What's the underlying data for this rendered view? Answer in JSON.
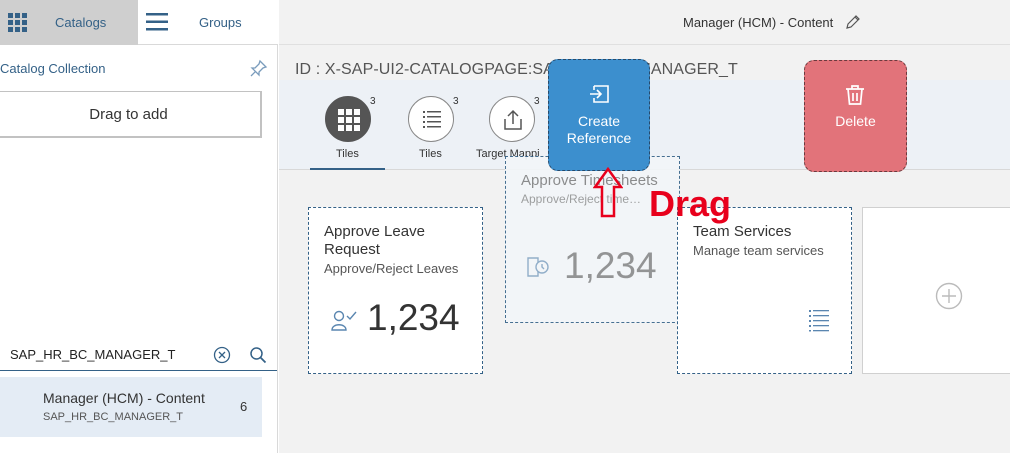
{
  "left": {
    "tabs": {
      "catalogs": "Catalogs",
      "groups": "Groups"
    },
    "collection_label": "Catalog Collection",
    "drag_to_add": "Drag to add",
    "search": {
      "value": "SAP_HR_BC_MANAGER_T"
    },
    "catalog_item": {
      "title": "Manager (HCM) - Content",
      "subtitle": "SAP_HR_BC_MANAGER_T",
      "count": "6"
    }
  },
  "main": {
    "header_title": "Manager (HCM) - Content",
    "page_id": "ID : X-SAP-UI2-CATALOGPAGE:SAP_HR_BC_MANAGER_T",
    "iconbar": [
      {
        "label": "Tiles",
        "count": "3",
        "icon": "grid-icon"
      },
      {
        "label": "Tiles",
        "count": "3",
        "icon": "list-icon"
      },
      {
        "label": "Target Mappi",
        "count": "3",
        "icon": "share-icon"
      }
    ],
    "tiles": [
      {
        "title_line1": "Approve Leave",
        "title_line2": "Request",
        "subtitle": "Approve/Reject Leaves",
        "number": "1,234",
        "icon": "person-check-icon"
      },
      {
        "title": "Approve Timesheets",
        "subtitle": "Approve/Reject time…",
        "number": "1,234",
        "icon": "timesheet-icon"
      },
      {
        "title": "Team Services",
        "subtitle": "Manage team services",
        "icon": "list-icon"
      }
    ],
    "drop_targets": {
      "create_reference_line1": "Create",
      "create_reference_line2": "Reference",
      "delete": "Delete"
    },
    "annotation": "Drag"
  },
  "colors": {
    "accent": "#346187",
    "create_ref": "#3c8fce",
    "delete": "#e2737a",
    "annotation": "#e8001c"
  }
}
